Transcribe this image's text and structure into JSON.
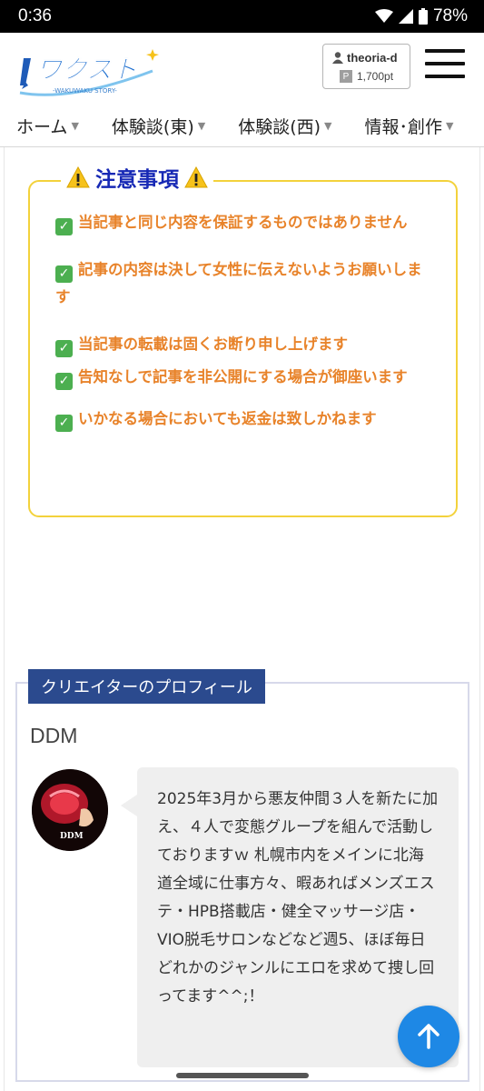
{
  "statusbar": {
    "time": "0:36",
    "battery": "78%"
  },
  "header": {
    "logo_text": "ワクスト",
    "logo_sub": "-WAKUWAKU STORY-",
    "user": {
      "name": "theoria-d",
      "points_badge": "P",
      "points": "1,700pt"
    }
  },
  "nav": {
    "items": [
      {
        "label": "ホーム"
      },
      {
        "label": "体験談(東)"
      },
      {
        "label": "体験談(西)"
      },
      {
        "label": "情報･創作"
      }
    ]
  },
  "notice": {
    "title": "注意事項",
    "items": [
      "当記事と同じ内容を保証するものではありません",
      "記事の内容は決して女性に伝えないようお願いします",
      "当記事の転載は固くお断り申し上げます",
      "告知なしで記事を非公開にする場合が御座います",
      "いかなる場合においても返金は致しかねます"
    ]
  },
  "profile": {
    "label": "クリエイターのプロフィール",
    "name": "DDM",
    "avatar_text": "DDM",
    "bio": "2025年3月から悪友仲間３人を新たに加え、４人で変態グループを組んで活動しておりますｗ 札幌市内をメインに北海道全域に仕事方々、暇あればメンズエステ・HPB搭載店・健全マッサージ店・VIO脱毛サロンなどなど週5、ほぼ毎日どれかのジャンルにエロを求めて捜し回ってます^^;！"
  },
  "colors": {
    "accent_blue": "#1e88e5",
    "notice_border": "#f3d23c",
    "notice_text": "#e8832a",
    "title_blue": "#1729b5",
    "label_bg": "#2b4a8e"
  }
}
